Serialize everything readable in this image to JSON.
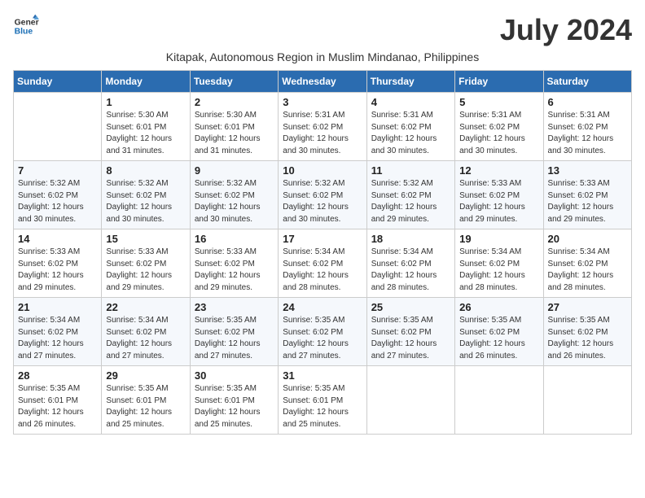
{
  "logo": {
    "line1": "General",
    "line2": "Blue"
  },
  "title": "July 2024",
  "location": "Kitapak, Autonomous Region in Muslim Mindanao, Philippines",
  "weekdays": [
    "Sunday",
    "Monday",
    "Tuesday",
    "Wednesday",
    "Thursday",
    "Friday",
    "Saturday"
  ],
  "weeks": [
    [
      {
        "day": "",
        "info": ""
      },
      {
        "day": "1",
        "info": "Sunrise: 5:30 AM\nSunset: 6:01 PM\nDaylight: 12 hours\nand 31 minutes."
      },
      {
        "day": "2",
        "info": "Sunrise: 5:30 AM\nSunset: 6:01 PM\nDaylight: 12 hours\nand 31 minutes."
      },
      {
        "day": "3",
        "info": "Sunrise: 5:31 AM\nSunset: 6:02 PM\nDaylight: 12 hours\nand 30 minutes."
      },
      {
        "day": "4",
        "info": "Sunrise: 5:31 AM\nSunset: 6:02 PM\nDaylight: 12 hours\nand 30 minutes."
      },
      {
        "day": "5",
        "info": "Sunrise: 5:31 AM\nSunset: 6:02 PM\nDaylight: 12 hours\nand 30 minutes."
      },
      {
        "day": "6",
        "info": "Sunrise: 5:31 AM\nSunset: 6:02 PM\nDaylight: 12 hours\nand 30 minutes."
      }
    ],
    [
      {
        "day": "7",
        "info": "Sunrise: 5:32 AM\nSunset: 6:02 PM\nDaylight: 12 hours\nand 30 minutes."
      },
      {
        "day": "8",
        "info": "Sunrise: 5:32 AM\nSunset: 6:02 PM\nDaylight: 12 hours\nand 30 minutes."
      },
      {
        "day": "9",
        "info": "Sunrise: 5:32 AM\nSunset: 6:02 PM\nDaylight: 12 hours\nand 30 minutes."
      },
      {
        "day": "10",
        "info": "Sunrise: 5:32 AM\nSunset: 6:02 PM\nDaylight: 12 hours\nand 30 minutes."
      },
      {
        "day": "11",
        "info": "Sunrise: 5:32 AM\nSunset: 6:02 PM\nDaylight: 12 hours\nand 29 minutes."
      },
      {
        "day": "12",
        "info": "Sunrise: 5:33 AM\nSunset: 6:02 PM\nDaylight: 12 hours\nand 29 minutes."
      },
      {
        "day": "13",
        "info": "Sunrise: 5:33 AM\nSunset: 6:02 PM\nDaylight: 12 hours\nand 29 minutes."
      }
    ],
    [
      {
        "day": "14",
        "info": "Sunrise: 5:33 AM\nSunset: 6:02 PM\nDaylight: 12 hours\nand 29 minutes."
      },
      {
        "day": "15",
        "info": "Sunrise: 5:33 AM\nSunset: 6:02 PM\nDaylight: 12 hours\nand 29 minutes."
      },
      {
        "day": "16",
        "info": "Sunrise: 5:33 AM\nSunset: 6:02 PM\nDaylight: 12 hours\nand 29 minutes."
      },
      {
        "day": "17",
        "info": "Sunrise: 5:34 AM\nSunset: 6:02 PM\nDaylight: 12 hours\nand 28 minutes."
      },
      {
        "day": "18",
        "info": "Sunrise: 5:34 AM\nSunset: 6:02 PM\nDaylight: 12 hours\nand 28 minutes."
      },
      {
        "day": "19",
        "info": "Sunrise: 5:34 AM\nSunset: 6:02 PM\nDaylight: 12 hours\nand 28 minutes."
      },
      {
        "day": "20",
        "info": "Sunrise: 5:34 AM\nSunset: 6:02 PM\nDaylight: 12 hours\nand 28 minutes."
      }
    ],
    [
      {
        "day": "21",
        "info": "Sunrise: 5:34 AM\nSunset: 6:02 PM\nDaylight: 12 hours\nand 27 minutes."
      },
      {
        "day": "22",
        "info": "Sunrise: 5:34 AM\nSunset: 6:02 PM\nDaylight: 12 hours\nand 27 minutes."
      },
      {
        "day": "23",
        "info": "Sunrise: 5:35 AM\nSunset: 6:02 PM\nDaylight: 12 hours\nand 27 minutes."
      },
      {
        "day": "24",
        "info": "Sunrise: 5:35 AM\nSunset: 6:02 PM\nDaylight: 12 hours\nand 27 minutes."
      },
      {
        "day": "25",
        "info": "Sunrise: 5:35 AM\nSunset: 6:02 PM\nDaylight: 12 hours\nand 27 minutes."
      },
      {
        "day": "26",
        "info": "Sunrise: 5:35 AM\nSunset: 6:02 PM\nDaylight: 12 hours\nand 26 minutes."
      },
      {
        "day": "27",
        "info": "Sunrise: 5:35 AM\nSunset: 6:02 PM\nDaylight: 12 hours\nand 26 minutes."
      }
    ],
    [
      {
        "day": "28",
        "info": "Sunrise: 5:35 AM\nSunset: 6:01 PM\nDaylight: 12 hours\nand 26 minutes."
      },
      {
        "day": "29",
        "info": "Sunrise: 5:35 AM\nSunset: 6:01 PM\nDaylight: 12 hours\nand 25 minutes."
      },
      {
        "day": "30",
        "info": "Sunrise: 5:35 AM\nSunset: 6:01 PM\nDaylight: 12 hours\nand 25 minutes."
      },
      {
        "day": "31",
        "info": "Sunrise: 5:35 AM\nSunset: 6:01 PM\nDaylight: 12 hours\nand 25 minutes."
      },
      {
        "day": "",
        "info": ""
      },
      {
        "day": "",
        "info": ""
      },
      {
        "day": "",
        "info": ""
      }
    ]
  ]
}
